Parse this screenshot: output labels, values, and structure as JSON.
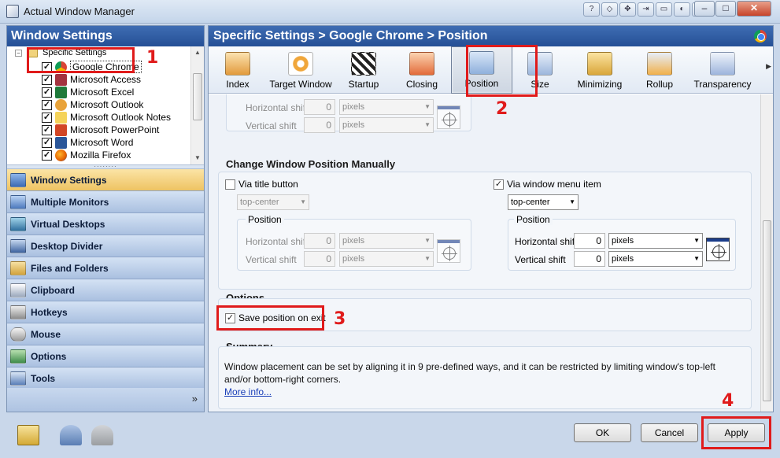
{
  "window": {
    "title": "Actual Window Manager",
    "minimize": "–",
    "restore": "□",
    "close": "✕"
  },
  "left": {
    "header": "Window Settings",
    "tree_root": "Specific Settings",
    "tree_items": [
      {
        "label": "Google Chrome",
        "icon": "chrome-icon",
        "checked": "✓"
      },
      {
        "label": "Microsoft Access",
        "icon": "access-icon",
        "checked": "✓"
      },
      {
        "label": "Microsoft Excel",
        "icon": "excel-icon",
        "checked": "✓"
      },
      {
        "label": "Microsoft Outlook",
        "icon": "outlook-icon",
        "checked": "✓"
      },
      {
        "label": "Microsoft Outlook Notes",
        "icon": "notes-icon",
        "checked": "✓"
      },
      {
        "label": "Microsoft PowerPoint",
        "icon": "powerpoint-icon",
        "checked": "✓"
      },
      {
        "label": "Microsoft Word",
        "icon": "word-icon",
        "checked": "✓"
      },
      {
        "label": "Mozilla Firefox",
        "icon": "firefox-icon",
        "checked": "✓"
      }
    ],
    "nav": [
      "Window Settings",
      "Multiple Monitors",
      "Virtual Desktops",
      "Desktop Divider",
      "Files and Folders",
      "Clipboard",
      "Hotkeys",
      "Mouse",
      "Options",
      "Tools"
    ],
    "nav_more": "»"
  },
  "right": {
    "header": "Specific Settings > Google Chrome > Position",
    "tabs": [
      "Index",
      "Target Window",
      "Startup",
      "Closing",
      "Position",
      "Size",
      "Minimizing",
      "Rollup",
      "Transparency"
    ],
    "top_group": {
      "horizontal_label": "Horizontal shift",
      "horizontal_value": "0",
      "horizontal_unit": "pixels",
      "vertical_label": "Vertical shift",
      "vertical_value": "0",
      "vertical_unit": "pixels"
    },
    "manual": {
      "title": "Change Window Position Manually",
      "title_button": {
        "label": "Via title button",
        "checked": "",
        "combo": "top-center",
        "position_title": "Position",
        "horizontal_label": "Horizontal shift",
        "horizontal_value": "0",
        "horizontal_unit": "pixels",
        "vertical_label": "Vertical shift",
        "vertical_value": "0",
        "vertical_unit": "pixels"
      },
      "menu_item": {
        "label": "Via window menu item",
        "checked": "✓",
        "combo": "top-center",
        "position_title": "Position",
        "horizontal_label": "Horizontal shift",
        "horizontal_value": "0",
        "horizontal_unit": "pixels",
        "vertical_label": "Vertical shift",
        "vertical_value": "0",
        "vertical_unit": "pixels"
      }
    },
    "options": {
      "title": "Options",
      "save_label": "Save position on exit",
      "save_checked": "✓"
    },
    "summary": {
      "title": "Summary",
      "text": "Window placement can be set by aligning it in 9 pre-defined ways, and it can be restricted by limiting window's top-left and/or bottom-right corners.",
      "link": "More info..."
    }
  },
  "buttons": {
    "ok": "OK",
    "cancel": "Cancel",
    "apply": "Apply"
  },
  "annotations": [
    "1",
    "2",
    "3",
    "4"
  ],
  "colors": {
    "header_blue": "#2b57a0",
    "active_nav": "#f3cf78",
    "annotation_red": "#e01b1b"
  }
}
